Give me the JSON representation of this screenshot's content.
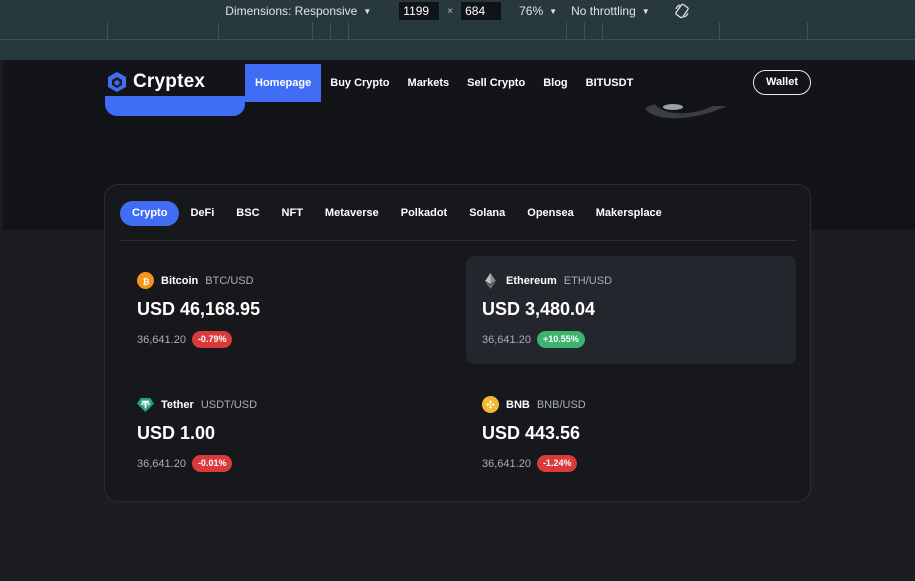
{
  "devtools": {
    "dimensions_label": "Dimensions: Responsive",
    "width": "1199",
    "height": "684",
    "zoom": "76%",
    "throttling": "No throttling",
    "times": "×"
  },
  "brand": {
    "name": "Cryptex"
  },
  "nav": {
    "items": [
      "Homepage",
      "Buy Crypto",
      "Markets",
      "Sell Crypto",
      "Blog",
      "BITUSDT"
    ],
    "wallet": "Wallet"
  },
  "tabs": [
    "Crypto",
    "DeFi",
    "BSC",
    "NFT",
    "Metaverse",
    "Polkadot",
    "Solana",
    "Opensea",
    "Makersplace"
  ],
  "coins": [
    {
      "name": "Bitcoin",
      "pair": "BTC/USD",
      "price": "USD 46,168.95",
      "volume": "36,641.20",
      "change": "-0.79%",
      "direction": "down",
      "icon": "bitcoin-icon",
      "color": "#f7931a"
    },
    {
      "name": "Ethereum",
      "pair": "ETH/USD",
      "price": "USD 3,480.04",
      "volume": "36,641.20",
      "change": "+10.55%",
      "direction": "up",
      "icon": "ethereum-icon",
      "color": "#8c8c8c"
    },
    {
      "name": "Tether",
      "pair": "USDT/USD",
      "price": "USD 1.00",
      "volume": "36,641.20",
      "change": "-0.01%",
      "direction": "down",
      "icon": "tether-icon",
      "color": "#26a17b"
    },
    {
      "name": "BNB",
      "pair": "BNB/USD",
      "price": "USD 443.56",
      "volume": "36,641.20",
      "change": "-1.24%",
      "direction": "down",
      "icon": "bnb-icon",
      "color": "#f3ba2f"
    }
  ],
  "colors": {
    "accent": "#3f6df4",
    "up": "#3cb46e",
    "down": "#d93a3a"
  }
}
